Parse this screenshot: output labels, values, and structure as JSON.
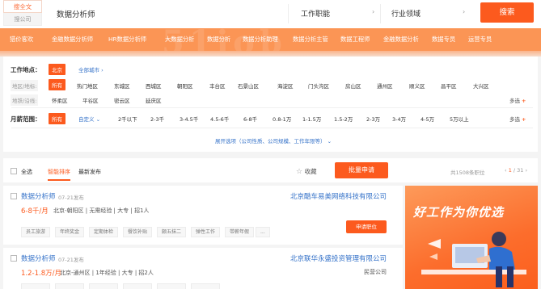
{
  "search": {
    "scope_active": "搜全文",
    "scope_inactive": "搜公司",
    "keyword": "数据分析师",
    "function_label": "工作职能",
    "industry_label": "行业领域",
    "button": "搜索"
  },
  "categories": [
    "猎价客欢",
    "金融数据分析师",
    "HR数据分析师",
    "大数据分析",
    "数据分析",
    "数据分析助理",
    "数据分析主管",
    "数据工程师",
    "金融数据分析",
    "数据专员",
    "运营专员"
  ],
  "filters": {
    "location_label": "工作地点：",
    "location_selected": "北京",
    "all_cities": "全部城市",
    "district_label": "地区/地标:",
    "metro_label": "地铁/沿线:",
    "all_chip": "所有",
    "districts_row1": [
      "热门地区",
      "东城区",
      "西城区",
      "朝阳区",
      "丰台区",
      "石景山区",
      "海淀区",
      "门头沟区",
      "房山区",
      "通州区",
      "顺义区",
      "昌平区",
      "大兴区"
    ],
    "districts_row2": [
      "怀柔区",
      "平谷区",
      "密云区",
      "延庆区"
    ],
    "more": "多选",
    "salary_label": "月薪范围：",
    "salary_custom": "自定义",
    "salary_options": [
      "2千以下",
      "2-3千",
      "3-4.5千",
      "4.5-6千",
      "6-8千",
      "0.8-1万",
      "1-1.5万",
      "1.5-2万",
      "2-3万",
      "3-4万",
      "4-5万",
      "5万以上"
    ],
    "expand": "展开选项（公司性质、公司规模、工作年限等）"
  },
  "sortbar": {
    "select_all": "全选",
    "smart_sort": "智能排序",
    "latest": "最新发布",
    "favorite": "收藏",
    "bulk_apply": "批量申请",
    "total": "共1508条职位",
    "page": "1",
    "pages": "/ 31"
  },
  "jobs": [
    {
      "title": "数据分析师",
      "date": "07-21发布",
      "company": "北京酷车易美网络科技有限公司",
      "salary": "6-8千/月",
      "meta": "北京-朝阳区 | 无需经验 | 大专 | 招1人",
      "company_type": "",
      "apply": "申请职位",
      "tags": [
        "员工旅游",
        "年终奖金",
        "定期体检",
        "餐饮补贴",
        "颇五抹二",
        "弹性工作",
        "带薪年假",
        "..."
      ]
    },
    {
      "title": "数据分析师",
      "date": "07-21发布",
      "company": "北京联华永盛投资管理有限公司",
      "salary": "1.2-1.8万/月",
      "meta": "北京-通州区 | 1年经验 | 大专 | 招2人",
      "company_type": "民营公司",
      "apply": "",
      "tags": [
        "",
        "",
        "",
        "",
        "",
        ""
      ]
    }
  ],
  "ad": {
    "headline": "好工作为你优选"
  },
  "colors": {
    "brand": "#fc5a1e",
    "link": "#3673c9",
    "banner": "#fb9555"
  }
}
